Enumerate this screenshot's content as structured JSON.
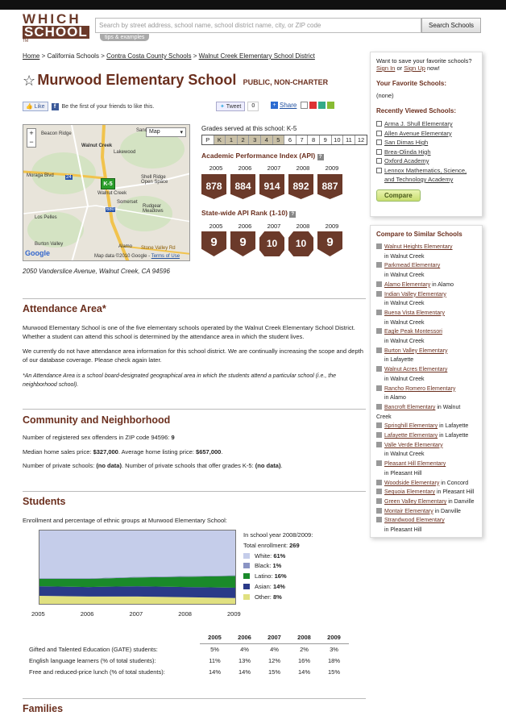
{
  "header": {
    "logo_top": "WHICH",
    "logo_bottom": "SCHOOL",
    "logo_tm": "TM",
    "search_placeholder": "Search by street address, school name, school district name, city, or ZIP code",
    "search_button": "Search Schools",
    "tips": "tips & examples"
  },
  "breadcrumb": {
    "items": [
      "Home",
      "California Schools",
      "Contra Costa County Schools",
      "Walnut Creek Elementary School District"
    ],
    "sep": ">"
  },
  "school": {
    "name": "Murwood Elementary School",
    "type": "PUBLIC, NON-CHARTER",
    "address": "2050 Vanderslice Avenue, Walnut Creek, CA 94596"
  },
  "social": {
    "like": "Like",
    "fb_text": "Be the first of your friends to like this.",
    "tweet": "Tweet",
    "tweet_count": "0",
    "share": "Share"
  },
  "map": {
    "type_select": "Map",
    "marker": "K-5",
    "labels": [
      "Beacon Ridge",
      "Walnut Creek",
      "Lakewood",
      "Shell Ridge Open Space",
      "Moraga Blvd",
      "Somerset",
      "Walnut Creek",
      "Rudgear Meadows",
      "Los Pelles",
      "Burton Valley",
      "Alamo",
      "Stone Valley Rd",
      "680",
      "24",
      "Sanc"
    ],
    "footer": "Map data ©2010 Google -",
    "terms": "Terms of Use",
    "brand": "Google"
  },
  "grades": {
    "label": "Grades served at this school: K-5",
    "all": [
      "P",
      "K",
      "1",
      "2",
      "3",
      "4",
      "5",
      "6",
      "7",
      "8",
      "9",
      "10",
      "11",
      "12"
    ],
    "served": [
      "K",
      "1",
      "2",
      "3",
      "4",
      "5"
    ]
  },
  "api": {
    "title": "Academic Performance Index (API)",
    "years": [
      "2005",
      "2006",
      "2007",
      "2008",
      "2009"
    ],
    "values": [
      "878",
      "884",
      "914",
      "892",
      "887"
    ]
  },
  "rank": {
    "title": "State-wide API Rank (1-10)",
    "years": [
      "2005",
      "2006",
      "2007",
      "2008",
      "2009"
    ],
    "values": [
      "9",
      "9",
      "10",
      "10",
      "9"
    ]
  },
  "attendance": {
    "heading": "Attendance Area*",
    "p1": "Murwood Elementary School is one of the five elementary schools operated by the Walnut Creek Elementary School District. Whether a student can attend this school is determined by the attendance area in which the student lives.",
    "p2": "We currently do not have attendance area information for this school district. We are continually increasing the scope and depth of our database coverage. Please check again later.",
    "note": "*An Attendance Area is a school board-designated geographical area in which the students attend a particular school (i.e., the neighborhood school)."
  },
  "community": {
    "heading": "Community and Neighborhood",
    "offenders_label": "Number of registered sex offenders in ZIP code 94596:",
    "offenders_value": "9",
    "home_label": "Median home sales price:",
    "home_value": "$327,000",
    "listing_label": "Average home listing price:",
    "listing_value": "$657,000",
    "private_label": "Number of private schools:",
    "private_value": "(no data)",
    "private_k5_label": "Number of private schools that offer grades K-5:",
    "private_k5_value": "(no data)"
  },
  "students": {
    "heading": "Students",
    "intro": "Enrollment and percentage of ethnic groups at Murwood Elementary School:",
    "year_label": "In school year 2008/2009:",
    "total_label": "Total enrollment:",
    "total": "269",
    "legend": [
      {
        "name": "White:",
        "value": "61%",
        "color": "#c5cdea"
      },
      {
        "name": "Black:",
        "value": "1%",
        "color": "#8a94c4"
      },
      {
        "name": "Latino:",
        "value": "16%",
        "color": "#1a8a2a"
      },
      {
        "name": "Asian:",
        "value": "14%",
        "color": "#2a3a88"
      },
      {
        "name": "Other:",
        "value": "8%",
        "color": "#e0e080"
      }
    ]
  },
  "chart_data": {
    "type": "area",
    "x": [
      "2005",
      "2006",
      "2007",
      "2008",
      "2009"
    ],
    "stacked": true,
    "ylim": [
      0,
      100
    ],
    "series": [
      {
        "name": "Other",
        "color": "#e0e080",
        "values": [
          11,
          10,
          10,
          9,
          8
        ]
      },
      {
        "name": "Asian",
        "color": "#2a3a88",
        "values": [
          13,
          13,
          14,
          14,
          14
        ]
      },
      {
        "name": "Latino",
        "color": "#1a8a2a",
        "values": [
          10,
          11,
          12,
          14,
          16
        ]
      },
      {
        "name": "Black",
        "color": "#8a94c4",
        "values": [
          1,
          1,
          1,
          1,
          1
        ]
      },
      {
        "name": "White",
        "color": "#c5cdea",
        "values": [
          65,
          65,
          63,
          62,
          61
        ]
      }
    ]
  },
  "programs": {
    "years": [
      "2005",
      "2006",
      "2007",
      "2008",
      "2009"
    ],
    "rows": [
      {
        "label": "Gifted and Talented Education (GATE) students:",
        "values": [
          "5%",
          "4%",
          "4%",
          "2%",
          "3%"
        ]
      },
      {
        "label": "English language learners (% of total students):",
        "values": [
          "11%",
          "13%",
          "12%",
          "16%",
          "18%"
        ]
      },
      {
        "label": "Free and reduced-price lunch (% of total students):",
        "values": [
          "14%",
          "14%",
          "15%",
          "14%",
          "15%"
        ]
      }
    ]
  },
  "families": {
    "heading": "Families"
  },
  "sidebar": {
    "save_text": "Want to save your favorite schools?",
    "sign_in": "Sign In",
    "or": "or",
    "sign_up": "Sign Up",
    "now": "now!",
    "fav_heading": "Your Favorite Schools:",
    "fav_none": "(none)",
    "recent_heading": "Recently Viewed Schools:",
    "recent": [
      "Arma J. Shull Elementary",
      "Allen Avenue Elementary",
      "San Dimas High",
      "Brea-Olinda High",
      "Oxford Academy",
      "Lennox Mathematics, Science, and Technology Academy"
    ],
    "compare": "Compare",
    "similar_heading": "Compare to Similar Schools",
    "similar": [
      {
        "name": "Walnut Heights Elementary",
        "city": "in Walnut Creek",
        "inline": false
      },
      {
        "name": "Parkmead Elementary",
        "city": "in Walnut Creek",
        "inline": false
      },
      {
        "name": "Alamo Elementary",
        "city": "in Alamo",
        "inline": true
      },
      {
        "name": "Indian Valley Elementary",
        "city": "in Walnut Creek",
        "inline": false
      },
      {
        "name": "Buena Vista Elementary",
        "city": "in Walnut Creek",
        "inline": false
      },
      {
        "name": "Eagle Peak Montessori",
        "city": "in Walnut Creek",
        "inline": false
      },
      {
        "name": "Burton Valley Elementary",
        "city": "in Lafayette",
        "inline": false
      },
      {
        "name": "Walnut Acres Elementary",
        "city": "in Walnut Creek",
        "inline": false
      },
      {
        "name": "Rancho Romero Elementary",
        "city": "in Alamo",
        "inline": false
      },
      {
        "name": "Bancroft Elementary",
        "city": "in Walnut Creek",
        "inline": true
      },
      {
        "name": "Springhill Elementary",
        "city": "in Lafayette",
        "inline": true
      },
      {
        "name": "Lafayette Elementary",
        "city": "in Lafayette",
        "inline": true
      },
      {
        "name": "Valle Verde Elementary",
        "city": "in Walnut Creek",
        "inline": false
      },
      {
        "name": "Pleasant Hill Elementary",
        "city": "in Pleasant Hill",
        "inline": false
      },
      {
        "name": "Woodside Elementary",
        "city": "in Concord",
        "inline": true
      },
      {
        "name": "Sequoia Elementary",
        "city": "in Pleasant Hill",
        "inline": true
      },
      {
        "name": "Green Valley Elementary",
        "city": "in Danville",
        "inline": true
      },
      {
        "name": "Montair Elementary",
        "city": "in Danville",
        "inline": true
      },
      {
        "name": "Strandwood Elementary",
        "city": "in Pleasant Hill",
        "inline": false
      }
    ]
  }
}
